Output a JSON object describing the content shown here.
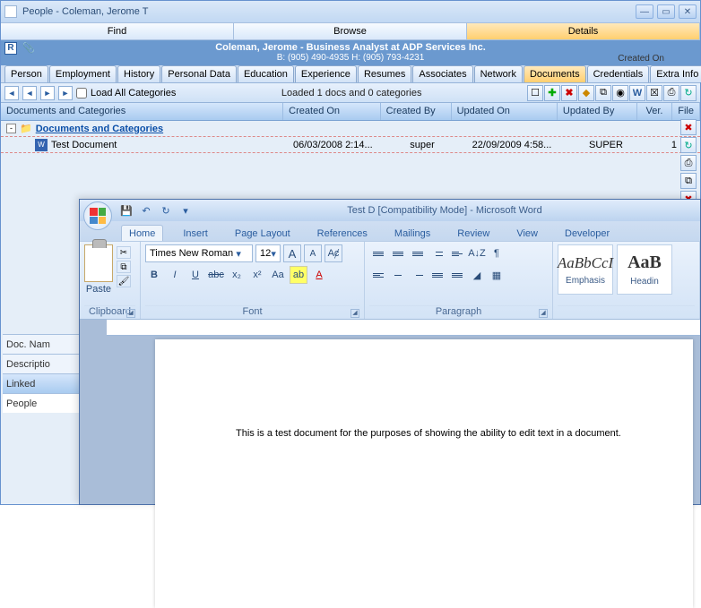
{
  "people": {
    "title": "People - Coleman, Jerome T",
    "winbtns": {
      "min": "—",
      "max": "▭",
      "close": "✕"
    },
    "topnav": [
      "Find",
      "Browse",
      "Details"
    ],
    "identity": {
      "name": "Coleman, Jerome - Business Analyst at ADP Services Inc.",
      "phones": "B: (905) 490-4935 H: (905) 793-4231",
      "created_label": "Created On",
      "r": "R"
    },
    "subtabs": [
      "Person",
      "Employment",
      "History",
      "Personal Data",
      "Education",
      "Experience",
      "Resumes",
      "Associates",
      "Network",
      "Documents",
      "Credentials",
      "Extra Info"
    ],
    "subtab_selected": 9,
    "loadbar": {
      "nav": [
        "◄",
        "◄",
        "►",
        "►"
      ],
      "load_label": "Load All Categories",
      "message": "Loaded 1 docs and 0 categories",
      "tbtns": {
        "new": "☐",
        "add": "✚",
        "del": "✖",
        "lock": "◆",
        "dup": "⧉",
        "cam": "◉",
        "word": "W",
        "x1": "☒",
        "print": "⎙",
        "ref": "↻"
      }
    },
    "grid": {
      "headers": [
        "Documents and Categories",
        "Created On",
        "Created By",
        "Updated On",
        "Updated By",
        "Ver.",
        "File"
      ],
      "root": "Documents and Categories",
      "rows": [
        {
          "name": "Test Document",
          "created": "06/03/2008 2:14...",
          "cby": "super",
          "updated": "22/09/2009 4:58...",
          "uby": "SUPER",
          "ver": "1"
        }
      ]
    },
    "lower": {
      "docname": "Doc. Nam",
      "desc": "Descriptio",
      "linked": "Linked",
      "people": "People"
    },
    "side": [
      "✖",
      "↻",
      "⎙",
      "⧉",
      "✖",
      "↻"
    ]
  },
  "word": {
    "title": "Test D [Compatibility Mode] - Microsoft Word",
    "qat": {
      "save": "💾",
      "undo": "↶",
      "redo": "↻",
      "dd": "▾"
    },
    "tabs": [
      "Home",
      "Insert",
      "Page Layout",
      "References",
      "Mailings",
      "Review",
      "View",
      "Developer"
    ],
    "paste": {
      "label": "Paste",
      "cut": "✂",
      "copy": "⧉",
      "fmt": "🖌"
    },
    "group_labels": {
      "clipboard": "Clipboard",
      "font": "Font",
      "para": "Paragraph"
    },
    "font": {
      "name": "Times New Roman",
      "size": "12",
      "grow": "A",
      "shrink": "A",
      "clear": "Aȼ",
      "bold": "B",
      "italic": "I",
      "under": "U",
      "strike": "abc",
      "sub": "x₂",
      "sup": "x²",
      "case": "Aa",
      "hl": "ab",
      "color": "A"
    },
    "para": {
      "sort": "A↓Z",
      "pilcrow": "¶",
      "shade": "◢",
      "border": "▦"
    },
    "styles": [
      {
        "sample": "AaBbCcI",
        "name": "Emphasis",
        "italic": true
      },
      {
        "sample": "AaB",
        "name": "Headin",
        "italic": false
      }
    ],
    "doc_text": "This is a test document for the purposes of showing the ability to edit text in a document."
  }
}
